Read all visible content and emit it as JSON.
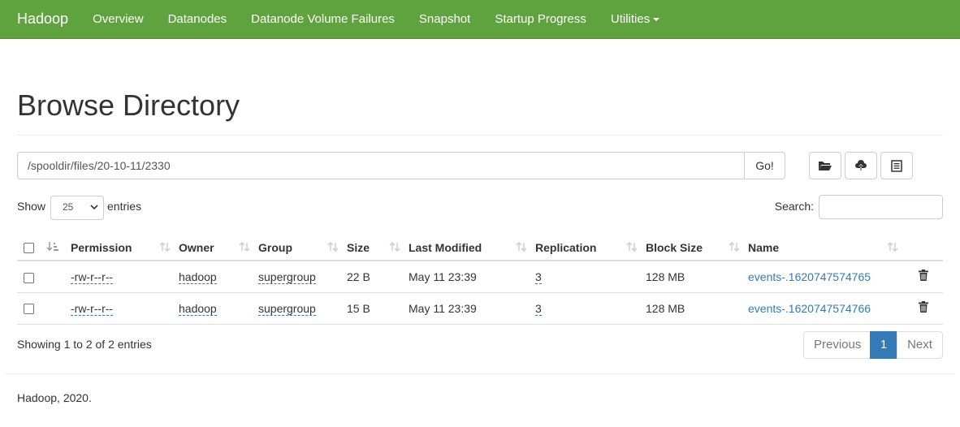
{
  "navbar": {
    "brand": "Hadoop",
    "items": [
      "Overview",
      "Datanodes",
      "Datanode Volume Failures",
      "Snapshot",
      "Startup Progress",
      "Utilities"
    ]
  },
  "page": {
    "title": "Browse Directory"
  },
  "path": {
    "value": "/spooldir/files/20-10-11/2330",
    "go_label": "Go!"
  },
  "controls": {
    "show_label": "Show",
    "entries_value": "25",
    "entries_label": "entries",
    "search_label": "Search:"
  },
  "table": {
    "columns": [
      "Permission",
      "Owner",
      "Group",
      "Size",
      "Last Modified",
      "Replication",
      "Block Size",
      "Name"
    ],
    "rows": [
      {
        "permission": "-rw-r--r--",
        "owner": "hadoop",
        "group": "supergroup",
        "size": "22 B",
        "modified": "May 11 23:39",
        "replication": "3",
        "block_size": "128 MB",
        "name": "events-.1620747574765"
      },
      {
        "permission": "-rw-r--r--",
        "owner": "hadoop",
        "group": "supergroup",
        "size": "15 B",
        "modified": "May 11 23:39",
        "replication": "3",
        "block_size": "128 MB",
        "name": "events-.1620747574766"
      }
    ]
  },
  "pagination": {
    "info": "Showing 1 to 2 of 2 entries",
    "previous": "Previous",
    "current": "1",
    "next": "Next"
  },
  "footer": {
    "text": "Hadoop, 2020."
  },
  "colors": {
    "navbar": "#5fa33e",
    "link": "#337ab7",
    "active_page": "#337ab7"
  }
}
